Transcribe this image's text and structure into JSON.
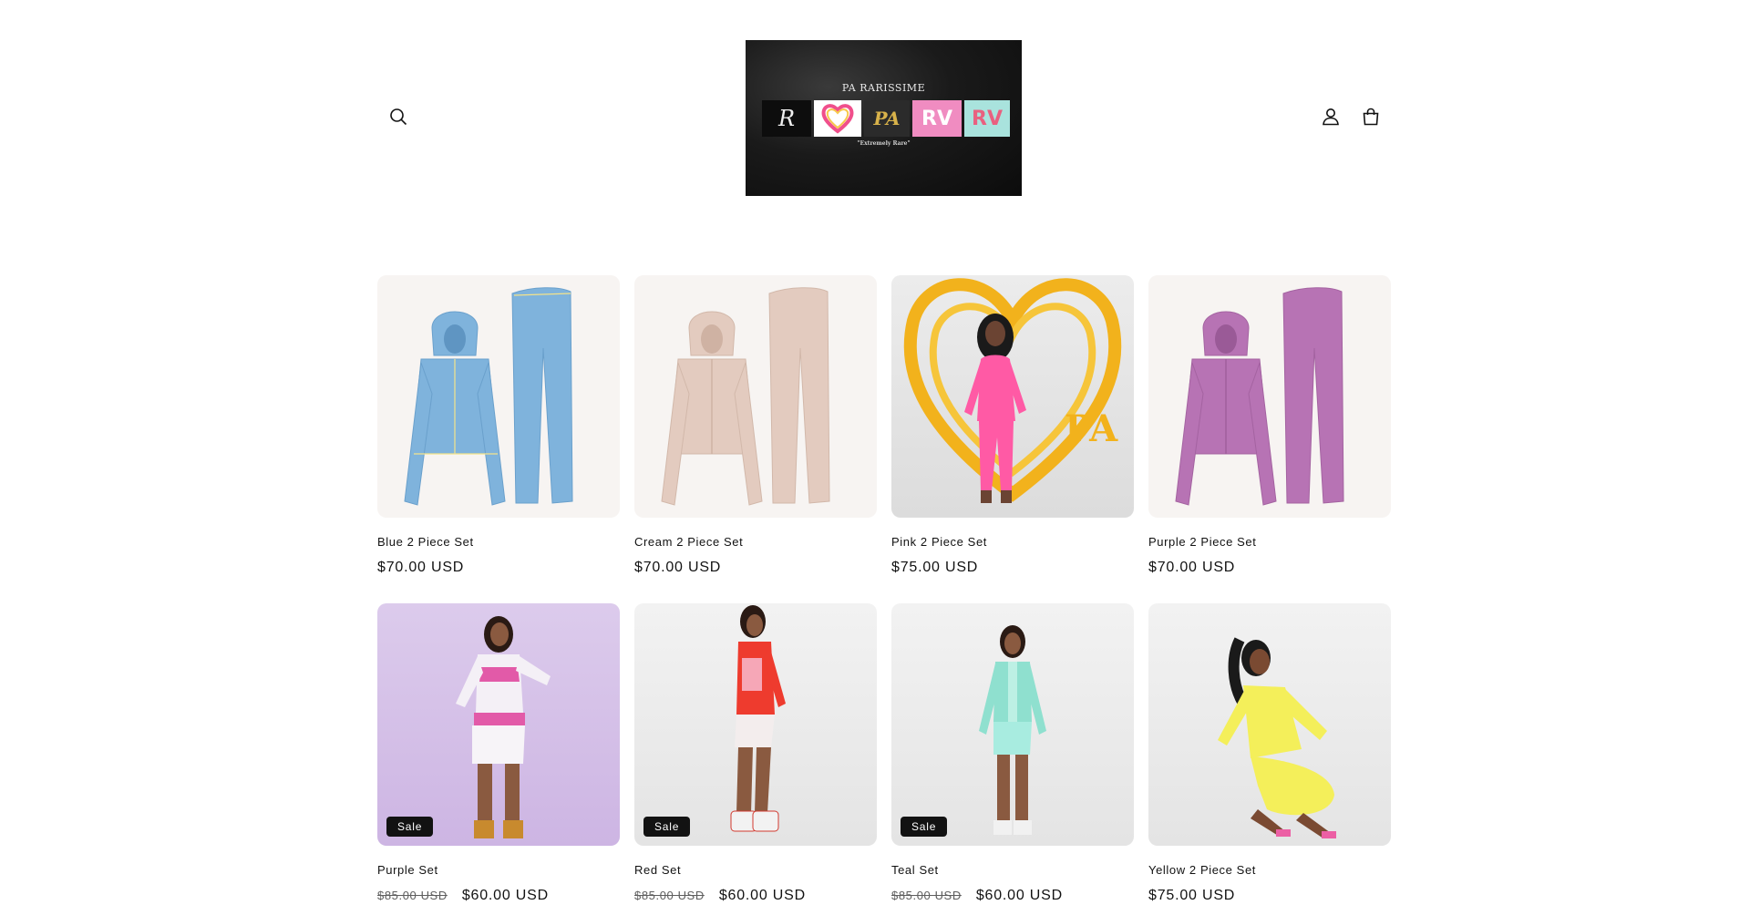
{
  "header": {
    "logo": {
      "title": "PA RARISSIME",
      "tiles": [
        "R",
        "PA",
        "RV",
        "RV"
      ],
      "tagline": "\"Extremely Rare\""
    },
    "icons": {
      "search": "search-icon",
      "account": "account-icon",
      "cart": "cart-icon"
    }
  },
  "products": [
    {
      "title": "Blue 2 Piece Set",
      "price": "$70.00 USD",
      "compare_price": "",
      "badge": "",
      "image": "blue-set",
      "color": "#7fb3dc"
    },
    {
      "title": "Cream 2 Piece Set",
      "price": "$70.00 USD",
      "compare_price": "",
      "badge": "",
      "image": "cream-set",
      "color": "#e3cbbf"
    },
    {
      "title": "Pink 2 Piece Set",
      "price": "$75.00 USD",
      "compare_price": "",
      "badge": "",
      "image": "pink-set",
      "color": "#ff5aa5"
    },
    {
      "title": "Purple 2 Piece Set",
      "price": "$70.00 USD",
      "compare_price": "",
      "badge": "",
      "image": "purple-set",
      "color": "#b773b4"
    },
    {
      "title": "Purple Set",
      "price": "$60.00 USD",
      "compare_price": "$85.00 USD",
      "badge": "Sale",
      "image": "purple-model",
      "color": "#f4f0f6"
    },
    {
      "title": "Red Set",
      "price": "$60.00 USD",
      "compare_price": "$85.00 USD",
      "badge": "Sale",
      "image": "red-model",
      "color": "#ee3b2e"
    },
    {
      "title": "Teal Set",
      "price": "$60.00 USD",
      "compare_price": "$85.00 USD",
      "badge": "Sale",
      "image": "teal-model",
      "color": "#8fe0cf"
    },
    {
      "title": "Yellow 2 Piece Set",
      "price": "$75.00 USD",
      "compare_price": "",
      "badge": "",
      "image": "yellow-model",
      "color": "#f4ef5a"
    }
  ]
}
